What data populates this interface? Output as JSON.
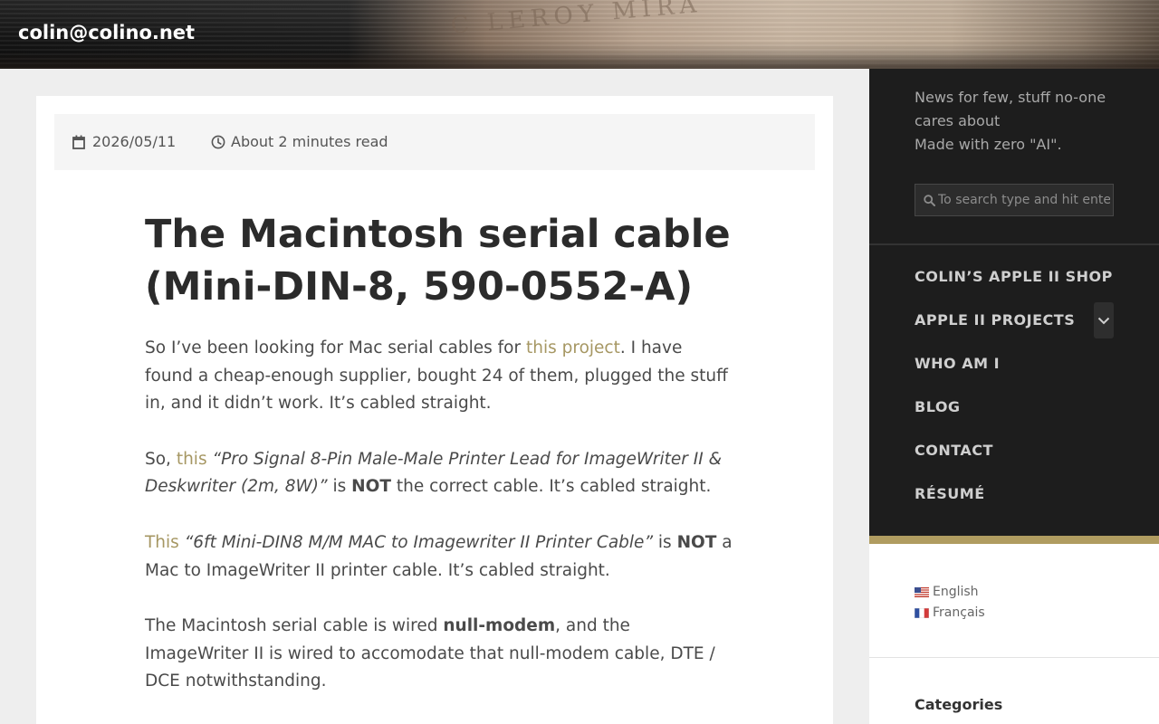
{
  "header": {
    "site_title": "colin@colino.net",
    "stamp_text": "C LEROY MIRA"
  },
  "post": {
    "date": "2026/05/11",
    "read_time": "About 2 minutes read",
    "title": "The Macintosh serial cable (Mini-DIN-8, 590-0552-A)",
    "p1": {
      "before": "So I’ve been looking for Mac serial cables for ",
      "link": "this project",
      "after": ". I have found a cheap-enough supplier, bought 24 of them, plugged the stuff in, and it didn’t work. It’s cabled straight."
    },
    "p2": {
      "before": "So, ",
      "link": "this",
      "quote": "“Pro Signal 8-Pin Male-Male Printer Lead for ImageWriter II & Deskwriter (2m, 8W)”",
      "is": " is ",
      "not": "NOT",
      "after": " the correct cable. It’s cabled straight."
    },
    "p3": {
      "link": "This",
      "quote": "“6ft Mini-DIN8 M/M MAC to Imagewriter II Printer Cable”",
      "is": " is ",
      "not": "NOT",
      "after": " a Mac to ImageWriter II printer cable. It’s cabled straight."
    },
    "p4": {
      "before": "The Macintosh serial cable is wired ",
      "bold": "null-modem",
      "after": ", and the ImageWriter II is wired to accomodate that null-modem cable, DTE / DCE notwithstanding."
    }
  },
  "sidebar": {
    "tagline_line1": "News for few, stuff no-one cares about",
    "tagline_line2": "Made with zero \"AI\".",
    "search_placeholder": "To search type and hit enter",
    "nav": [
      {
        "label": "Colin’s Apple II shop"
      },
      {
        "label": "Apple II Projects"
      },
      {
        "label": "Who am I"
      },
      {
        "label": "Blog"
      },
      {
        "label": "Contact"
      },
      {
        "label": "Résumé"
      }
    ],
    "languages": [
      {
        "label": "English"
      },
      {
        "label": "Français"
      }
    ],
    "categories_title": "Categories"
  },
  "colors": {
    "link": "#a69763",
    "accent_bar": "#b09c60",
    "sidebar_bg": "#1d1d1d"
  }
}
